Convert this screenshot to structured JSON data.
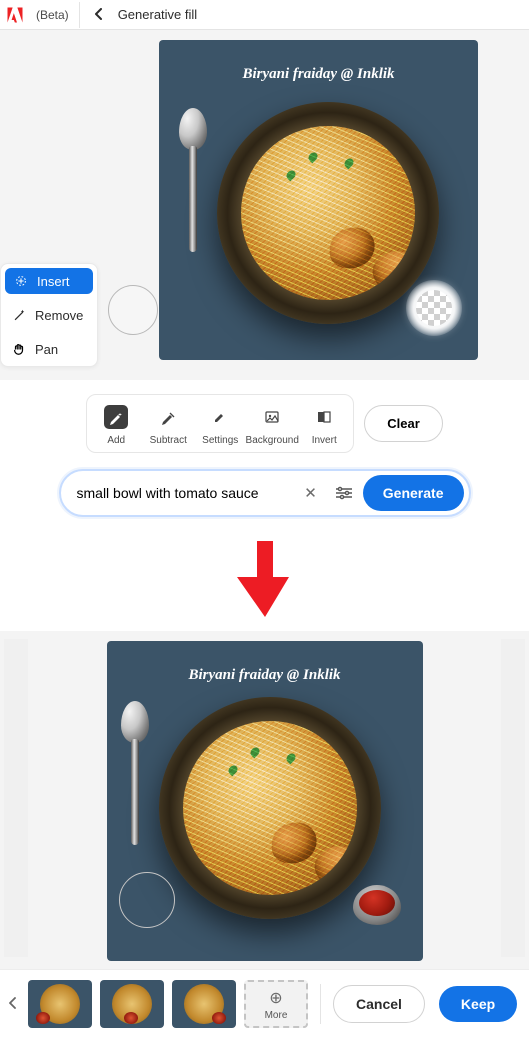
{
  "header": {
    "beta": "(Beta)",
    "title": "Generative fill"
  },
  "tools": {
    "insert": "Insert",
    "remove": "Remove",
    "pan": "Pan"
  },
  "canvas_caption": "Biryani fraiday @ Inklik",
  "toolbar": {
    "add": "Add",
    "subtract": "Subtract",
    "settings": "Settings",
    "background": "Background",
    "invert": "Invert",
    "clear": "Clear"
  },
  "prompt": {
    "value": "small bowl with tomato sauce",
    "generate": "Generate"
  },
  "result_caption": "Biryani fraiday @ Inklik",
  "footer": {
    "more": "More",
    "cancel": "Cancel",
    "keep": "Keep"
  }
}
